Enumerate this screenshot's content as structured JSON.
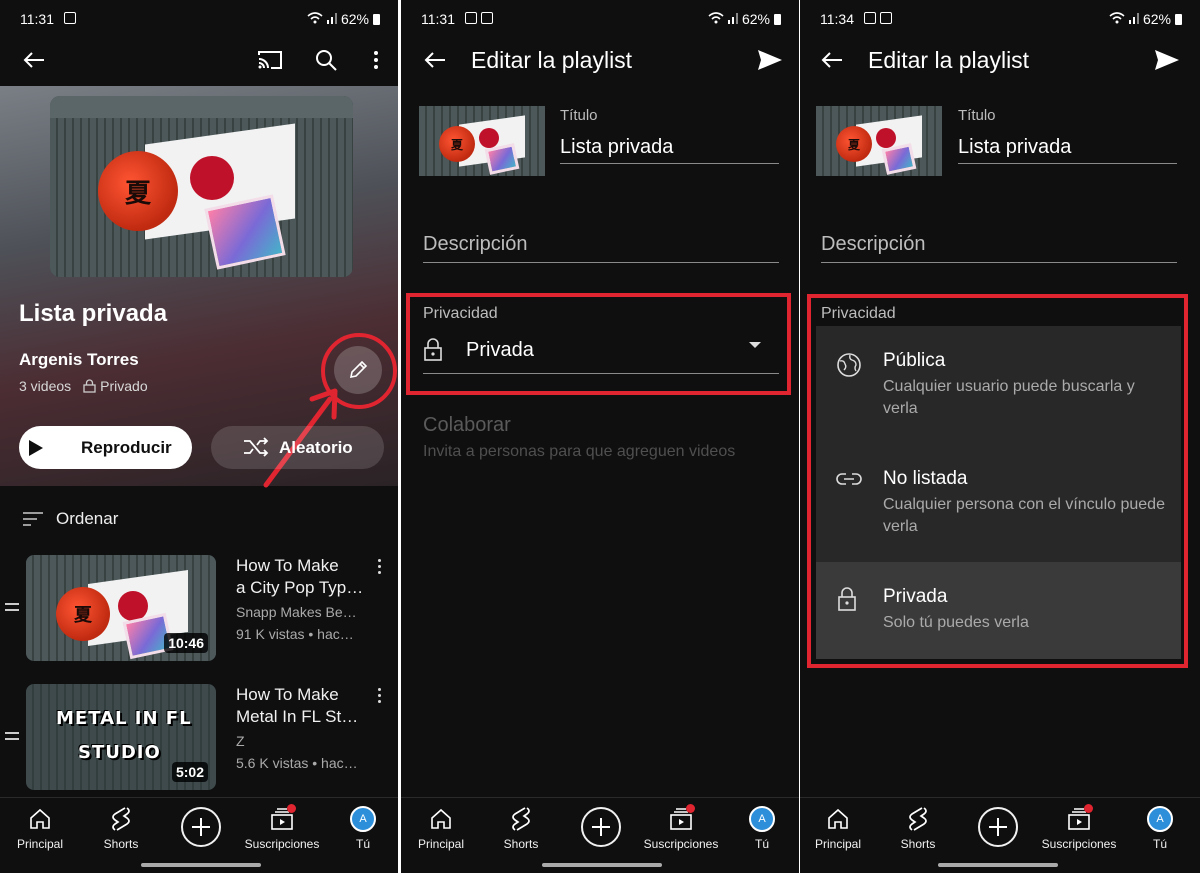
{
  "status_bar": [
    {
      "time": "11:31",
      "battery": "62%"
    },
    {
      "time": "11:31",
      "battery": "62%"
    },
    {
      "time": "11:34",
      "battery": "62%"
    }
  ],
  "playlist": {
    "title": "Lista privada",
    "author": "Argenis Torres",
    "video_count": "3 videos",
    "privacy": "Privado",
    "play_label": "Reproducir",
    "shuffle_label": "Aleatorio",
    "sort_label": "Ordenar",
    "videos": [
      {
        "title_line1": "How To Make",
        "title_line2": "a City Pop Typ…",
        "channel": "Snapp Makes Be…",
        "meta": "91 K vistas • hac…",
        "duration": "10:46"
      },
      {
        "title_line1": "How To Make",
        "title_line2": "Metal In FL St…",
        "channel": "Z",
        "meta": "5.6 K vistas • hac…",
        "duration": "5:02",
        "thumb_text1": "METAL IN FL",
        "thumb_text2": "STUDIO"
      }
    ]
  },
  "edit": {
    "header": "Editar la playlist",
    "title_label": "Título",
    "title_value": "Lista privada",
    "description_placeholder": "Descripción",
    "privacy_label": "Privacidad",
    "privacy_value": "Privada",
    "collab_title": "Colaborar",
    "collab_sub": "Invita a personas para que agreguen videos"
  },
  "privacy_menu": {
    "label": "Privacidad",
    "options": [
      {
        "title": "Pública",
        "sub": "Cualquier usuario puede buscarla y verla",
        "icon": "globe-icon"
      },
      {
        "title": "No listada",
        "sub": "Cualquier persona con el vínculo puede verla",
        "icon": "link-icon"
      },
      {
        "title": "Privada",
        "sub": "Solo tú puedes verla",
        "icon": "lock-icon",
        "selected": true
      }
    ]
  },
  "nav": {
    "home": "Principal",
    "shorts": "Shorts",
    "subs": "Suscripciones",
    "you": "Tú",
    "avatar_letter": "A"
  },
  "colors": {
    "background": "#0f0f0f",
    "highlight": "#e02530",
    "menu": "#282828",
    "avatar": "#2d8fd9"
  }
}
